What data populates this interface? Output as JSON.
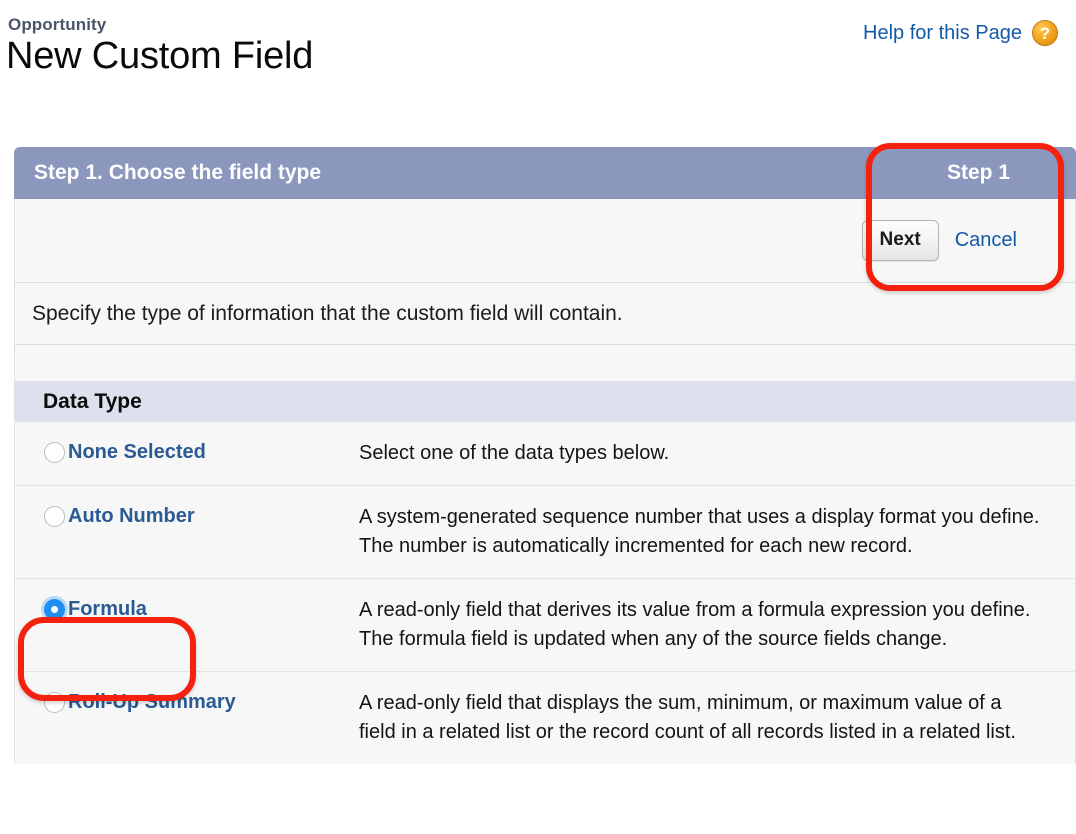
{
  "header": {
    "breadcrumb": "Opportunity",
    "title": "New Custom Field",
    "help_link": "Help for this Page",
    "help_icon": "question-mark-icon"
  },
  "panel": {
    "title": "Step 1. Choose the field type",
    "step_badge": "Step 1",
    "next_label": "Next",
    "cancel_label": "Cancel",
    "instruction": "Specify the type of information that the custom field will contain.",
    "section_header": "Data Type"
  },
  "data_types": [
    {
      "label": "None Selected",
      "description": "Select one of the data types below.",
      "selected": false
    },
    {
      "label": "Auto Number",
      "description": "A system-generated sequence number that uses a display format you define. The number is automatically incremented for each new record.",
      "selected": false
    },
    {
      "label": "Formula",
      "description": "A read-only field that derives its value from a formula expression you define. The formula field is updated when any of the source fields change.",
      "selected": true
    },
    {
      "label": "Roll-Up Summary",
      "description": "A read-only field that displays the sum, minimum, or maximum value of a field in a related list or the record count of all records listed in a related list.",
      "selected": false
    }
  ],
  "colors": {
    "panel_header_blue": "#8b97bd",
    "section_header_lavender": "#dde1ee",
    "link_blue": "#1259a8",
    "label_blue": "#2a5b93",
    "selected_radio_blue": "#1f8ef1",
    "annotation_red": "#f4210f",
    "help_icon_orange": "#f3a521"
  }
}
